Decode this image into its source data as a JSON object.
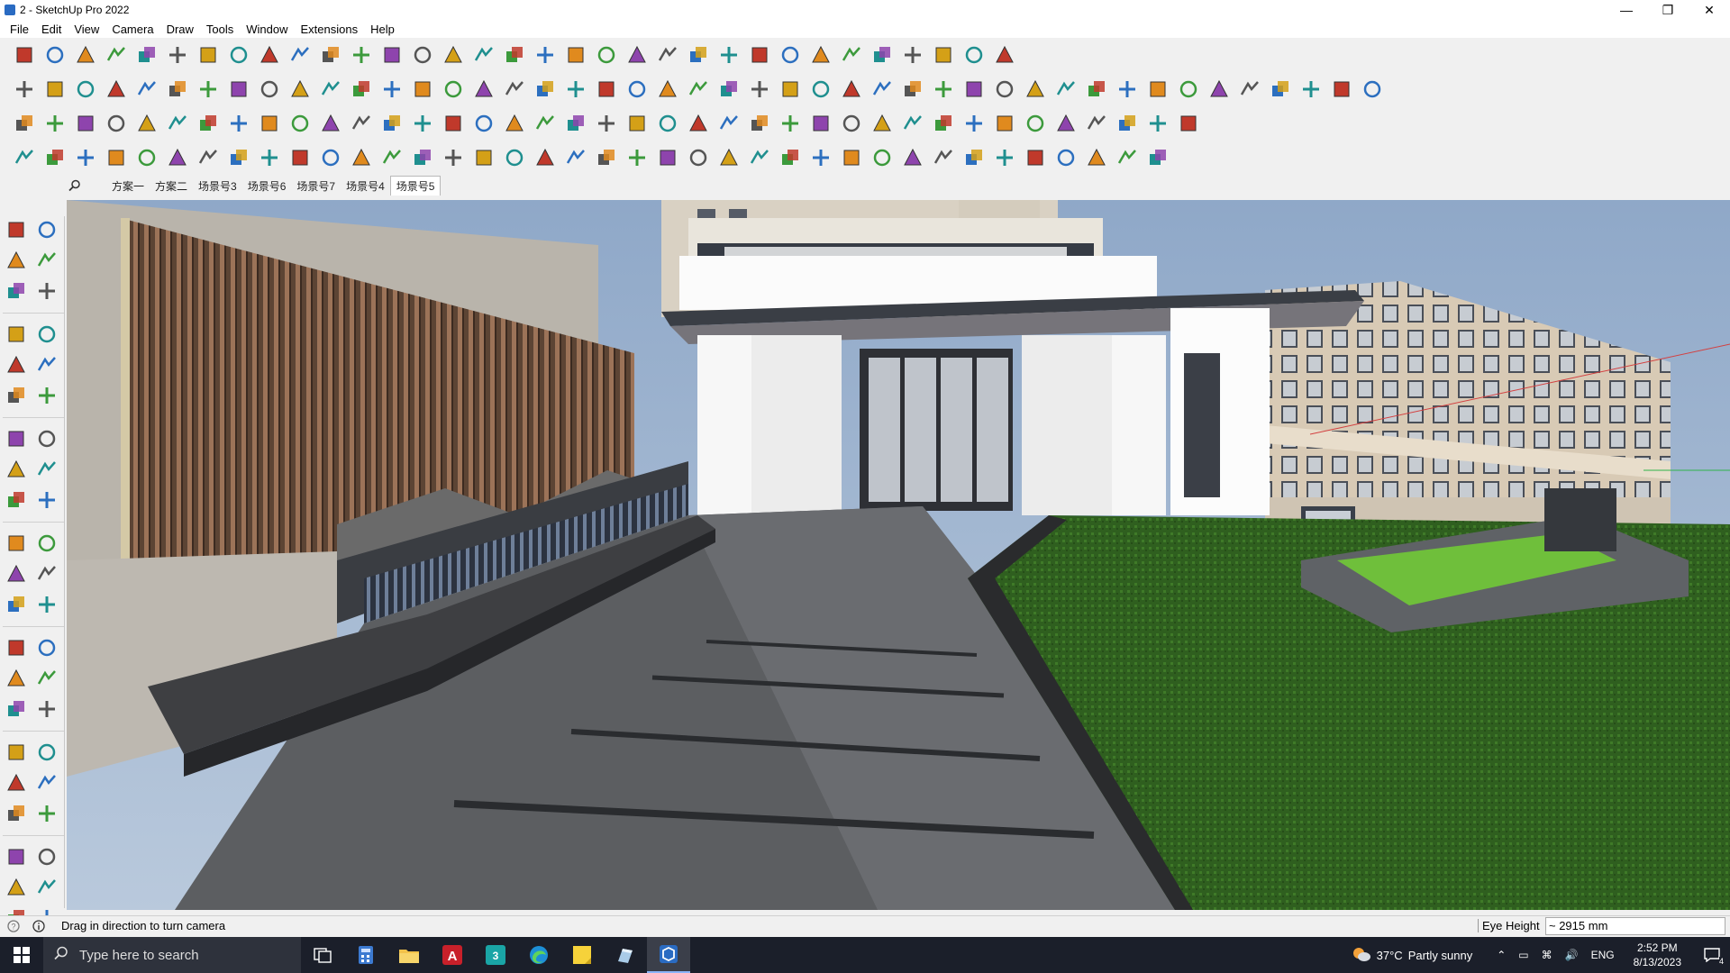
{
  "window": {
    "title": "2 - SketchUp Pro 2022",
    "controls": [
      "minimize",
      "maximize",
      "close"
    ]
  },
  "menu": [
    "File",
    "Edit",
    "View",
    "Camera",
    "Draw",
    "Tools",
    "Window",
    "Extensions",
    "Help"
  ],
  "toolbars": {
    "row1": [
      "zoom-icon",
      "select-icon",
      "eraser-icon",
      "pencil-icon",
      "arc-icon",
      "rectangle-icon",
      "push-pull-icon",
      "follow-me-icon",
      "move-icon",
      "rotate-icon",
      "scale-icon",
      "tape-icon",
      "text-icon",
      "paint-icon",
      "orbit-icon",
      "pan-icon",
      "zoom-window-icon",
      "zoom-extents-icon",
      "components-icon",
      "sandbox-icon",
      "layers-icon",
      "layers2-icon",
      "user-icon",
      "warehouse-icon",
      "extension-icon",
      "add-location-icon",
      "arrow-up-down-icon",
      "arrow-up-icon",
      "solid-icon",
      "section-icon",
      "undo-icon",
      "redo-icon",
      "ruby-icon"
    ],
    "row2": [
      "cube-icon",
      "box-icon",
      "box-outline-icon",
      "push-icon",
      "arrow-down-icon",
      "arrow-tool-icon",
      "arrow-tool-icon",
      "arrow-tool-icon",
      "arrow-tool-icon",
      "arrow-tool-icon",
      "arrow-tool-icon",
      "curve-icon",
      "plane-icon",
      "plane-icon",
      "plane-icon",
      "green-plane-icon",
      "green-star-icon",
      "house-icon",
      "house-icon",
      "house-icon",
      "house-icon",
      "house-icon",
      "house-icon",
      "fx-icon",
      "hand-icon",
      "pen-icon",
      "shape-icon",
      "shape-icon",
      "shape-icon",
      "shape-icon",
      "shape-icon",
      "shape-icon",
      "shape-icon",
      "shape-icon",
      "shape-icon",
      "shape-icon",
      "line-red-icon",
      "eraser-pink-icon",
      "brick-icon",
      "wall-icon",
      "texture-icon",
      "texture-icon",
      "texture-icon",
      "texture-icon",
      "texture-icon"
    ],
    "row3": [
      "blue-tile-icon",
      "blue-tile-icon",
      "yellow-tile-icon",
      "green-tile-icon",
      "red-tile-icon",
      "white-tile-icon",
      "orange-curve-icon",
      "red-square-icon",
      "grid-icon",
      "page-icon",
      "box-tool-icon",
      "tube-icon",
      "wire-icon",
      "curve-dots-icon",
      "cross-red-icon",
      "cross-green-icon",
      "cross-blue-icon",
      "cone-icon",
      "cone-icon",
      "triangle-icon",
      "loop-icon",
      "loop-icon",
      "loop-icon",
      "dots-icon",
      "cup-icon",
      "hook-icon",
      "nodes-icon",
      "nodes-icon",
      "nodes-icon",
      "nodes-icon",
      "nodes-icon",
      "nodes-icon",
      "frame-icon",
      "orange-grid-icon",
      "orange-grid-icon",
      "orange-grid-icon",
      "scatter-icon",
      "curve-points-icon",
      "panel-icon"
    ],
    "row4": [
      "path-icon",
      "path-icon",
      "path-icon",
      "path-icon",
      "gear-icon",
      "flow-icon",
      "flow-icon",
      "flow-icon",
      "step-icon",
      "step-icon",
      "step-icon",
      "step-icon",
      "arc-tool-icon",
      "arch-icon",
      "stairs-icon",
      "stairs-icon",
      "stairs-icon",
      "leaf-icon",
      "leaf-icon",
      "leaf-icon",
      "leaf-icon",
      "leaf-icon",
      "leaf-icon",
      "leaf-icon",
      "leaf-icon",
      "leaf-icon",
      "stairs-icon",
      "stairs-icon",
      "stairs-icon",
      "stairs-icon",
      "stairs-icon",
      "stairs-icon",
      "stairs-icon",
      "stairs-icon",
      "stairs-icon",
      "stairs-icon",
      "stairs-icon",
      "stairs-icon"
    ]
  },
  "scenes": {
    "tabs": [
      "方案一",
      "方案二",
      "场景号3",
      "场景号6",
      "场景号7",
      "场景号4",
      "场景号5"
    ],
    "active": "场景号5"
  },
  "left_palette": [
    "select-icon",
    "orbit-icon",
    "paint-icon",
    "eraser-icon",
    "component-icon",
    "tape-icon",
    "line-icon",
    "freehand-icon",
    "rectangle-icon",
    "rotated-rect-icon",
    "circle-icon",
    "polygon-icon",
    "arc-icon",
    "arc2-icon",
    "pie-icon",
    "arc3-icon",
    "move-icon",
    "push-pull-icon",
    "rotate-icon",
    "follow-me-icon",
    "scale-icon",
    "offset-icon",
    "tape-measure-icon",
    "dimension-icon",
    "protractor-icon",
    "text-icon",
    "axes-icon",
    "3d-text-icon",
    "orbit-tool-icon",
    "pan-icon",
    "zoom-icon",
    "zoom-window-icon",
    "zoom-extents-icon",
    "previous-view-icon",
    "position-camera-icon",
    "look-around-icon",
    "walk-icon",
    "section-plane-icon",
    "sandbox-icon",
    "sandbox2-icon",
    "layers-icon",
    "layers2-icon"
  ],
  "status": {
    "hint": "Drag in direction to turn camera",
    "vcb_label": "Eye Height",
    "vcb_value": "~ 2915 mm"
  },
  "taskbar": {
    "search_placeholder": "Type here to search",
    "weather_temp": "37°C",
    "weather_text": "Partly sunny",
    "language": "ENG",
    "time": "2:52 PM",
    "date": "8/13/2023",
    "notification_count": "4"
  }
}
